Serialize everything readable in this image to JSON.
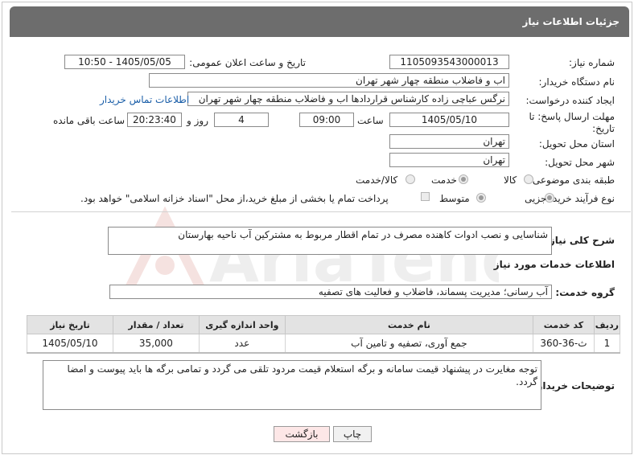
{
  "header": {
    "title": "جزئیات اطلاعات نیاز"
  },
  "form": {
    "need_number_label": "شماره نیاز:",
    "need_number": "1105093543000013",
    "announce_label": "تاریخ و ساعت اعلان عمومی:",
    "announce_value": "1405/05/05 - 10:50",
    "buyer_org_label": "نام دستگاه خریدار:",
    "buyer_org": "اب و فاضلاب منطقه چهار شهر تهران",
    "creator_label": "ایجاد کننده درخواست:",
    "creator": "نرگس عباچی زاده کارشناس قراردادها اب و فاضلاب منطقه چهار شهر تهران",
    "contact_link": "اطلاعات تماس خریدار",
    "deadline_label": "مهلت ارسال پاسخ: تا تاریخ:",
    "deadline_date": "1405/05/10",
    "time_label": "ساعت",
    "deadline_time": "09:00",
    "days_value": "4",
    "days_label": "روز و",
    "remaining_time": "20:23:40",
    "remaining_label": "ساعت باقی مانده",
    "province_label": "استان محل تحویل:",
    "province": "تهران",
    "city_label": "شهر محل تحویل:",
    "city": "تهران",
    "category_label": "طبقه بندی موضوعی:",
    "category_options": [
      "کالا",
      "خدمت",
      "کالا/خدمت"
    ],
    "category_selected": "خدمت",
    "process_label": "نوع فرآیند خرید :",
    "process_options": [
      "جزیی",
      "متوسط"
    ],
    "process_selected": "جزیی",
    "payment_note": "پرداخت تمام یا بخشی از مبلغ خرید،از محل \"اسناد خزانه اسلامی\" خواهد بود."
  },
  "description": {
    "label": "شرح کلی نیاز:",
    "text": "شناسایی و نصب ادوات کاهنده مصرف در تمام اقطار مربوط به مشترکین آب ناحیه بهارستان"
  },
  "services": {
    "section_title": "اطلاعات خدمات مورد نیاز",
    "group_label": "گروه خدمت:",
    "group_value": "آب رسانی؛ مدیریت پسماند، فاضلاب و فعالیت های تصفیه",
    "columns": [
      "ردیف",
      "کد خدمت",
      "نام خدمت",
      "واحد اندازه گیری",
      "تعداد / مقدار",
      "تاریخ نیاز"
    ],
    "rows": [
      {
        "row": "1",
        "code": "ث-36-360",
        "name": "جمع آوری، تصفیه و تامین آب",
        "unit": "عدد",
        "qty": "35,000",
        "date": "1405/05/10"
      }
    ]
  },
  "buyer_notes": {
    "label": "توضیحات خریدار:",
    "text": "توجه مغایرت در پیشنهاد قیمت سامانه و برگه استعلام قیمت  مردود تلقی می گردد و تمامی برگه ها باید  پیوست و امضا گردد."
  },
  "buttons": {
    "print": "چاپ",
    "back": "بازگشت"
  },
  "watermark": {
    "text": "AriaTender.net"
  },
  "colors": {
    "header_bg": "#6d6d6d",
    "link": "#1a5ea8",
    "back_button_bg": "#fde7e7",
    "print_button_bg": "#f1f1f1"
  }
}
